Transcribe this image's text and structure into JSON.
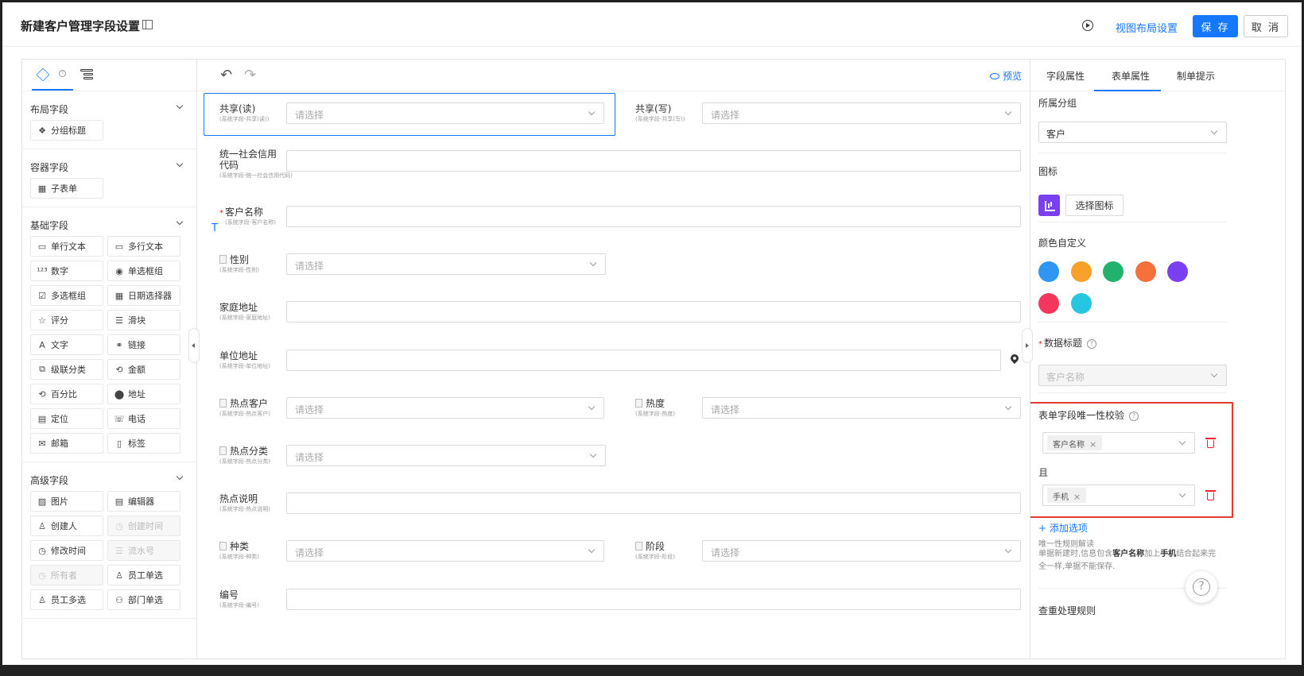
{
  "header": {
    "title": "新建客户管理字段设置",
    "view_layout_label": "视图布局设置",
    "save_label": "保 存",
    "cancel_label": "取 消"
  },
  "left_panel": {
    "groups": [
      {
        "name": "布局字段",
        "items": [
          {
            "label": "分组标题",
            "icon": "❖"
          }
        ]
      },
      {
        "name": "容器字段",
        "items": [
          {
            "label": "子表单",
            "icon": "▦"
          }
        ]
      },
      {
        "name": "基础字段",
        "items": [
          {
            "label": "单行文本",
            "icon": "▭"
          },
          {
            "label": "多行文本",
            "icon": "▭"
          },
          {
            "label": "数字",
            "icon": "¹²³"
          },
          {
            "label": "单选框组",
            "icon": "◉"
          },
          {
            "label": "多选框组",
            "icon": "☑"
          },
          {
            "label": "日期选择器",
            "icon": "▦"
          },
          {
            "label": "评分",
            "icon": "☆"
          },
          {
            "label": "滑块",
            "icon": "☰"
          },
          {
            "label": "文字",
            "icon": "A"
          },
          {
            "label": "链接",
            "icon": "⚭"
          },
          {
            "label": "级联分类",
            "icon": "⧉"
          },
          {
            "label": "金额",
            "icon": "⟲"
          },
          {
            "label": "百分比",
            "icon": "⟲"
          },
          {
            "label": "地址",
            "icon": "⬤"
          },
          {
            "label": "定位",
            "icon": "▤"
          },
          {
            "label": "电话",
            "icon": "☏"
          },
          {
            "label": "邮箱",
            "icon": "✉"
          },
          {
            "label": "标签",
            "icon": "▯"
          }
        ]
      },
      {
        "name": "高级字段",
        "items": [
          {
            "label": "图片",
            "icon": "▨"
          },
          {
            "label": "编辑器",
            "icon": "▤"
          },
          {
            "label": "创建人",
            "icon": "♙"
          },
          {
            "label": "创建时间",
            "icon": "◷",
            "disabled": true
          },
          {
            "label": "修改时间",
            "icon": "◷"
          },
          {
            "label": "流水号",
            "icon": "☰",
            "disabled": true
          },
          {
            "label": "所有者",
            "icon": "◷",
            "disabled": true
          },
          {
            "label": "员工单选",
            "icon": "♙"
          },
          {
            "label": "员工多选",
            "icon": "♙"
          },
          {
            "label": "部门单选",
            "icon": "⚇"
          }
        ]
      }
    ]
  },
  "toolbar": {
    "preview_label": "预览"
  },
  "form": {
    "placeholder": "请选择",
    "fields": {
      "share_read": {
        "label": "共享(读)",
        "sub": "(系统字段-共享(读))"
      },
      "share_write": {
        "label": "共享(写)",
        "sub": "(系统字段-共享(写))"
      },
      "credit_code": {
        "label1": "统一社会信用",
        "label2": "代码",
        "sub": "(系统字段-统一社会信用代码)"
      },
      "customer_name": {
        "label": "客户名称",
        "sub": "(系统字段-客户名称)"
      },
      "gender": {
        "label": "性别",
        "sub": "(系统字段-性别)"
      },
      "home_address": {
        "label": "家庭地址",
        "sub": "(系统字段-家庭地址)"
      },
      "work_address": {
        "label": "单位地址",
        "sub": "(系统字段-单位地址)"
      },
      "hot_customer": {
        "label": "热点客户",
        "sub": "(系统字段-热点客户)"
      },
      "heat": {
        "label": "热度",
        "sub": "(系统字段-热度)"
      },
      "hot_category": {
        "label": "热点分类",
        "sub": "(系统字段-热点分类)"
      },
      "hot_desc": {
        "label": "热点说明",
        "sub": "(系统字段-热点说明)"
      },
      "kind": {
        "label": "种类",
        "sub": "(系统字段-种类)"
      },
      "stage": {
        "label": "阶段",
        "sub": "(系统字段-阶段)"
      },
      "number": {
        "label": "编号",
        "sub": "(系统字段-编号)"
      }
    }
  },
  "right_panel": {
    "tabs": [
      "字段属性",
      "表单属性",
      "制单提示"
    ],
    "group_label": "所属分组",
    "group_value": "客户",
    "icon_label": "图标",
    "choose_icon_label": "选择图标",
    "color_label": "颜色自定义",
    "colors": [
      "#2f96f3",
      "#f7a12b",
      "#23b26d",
      "#f5703b",
      "#7b3ff2",
      "#f5365c",
      "#26c6e0"
    ],
    "data_title_label": "数据标题",
    "data_title_value": "客户名称",
    "unique_label": "表单字段唯一性校验",
    "unique_tag_1": "客户名称",
    "and_label": "且",
    "unique_tag_2": "手机",
    "add_option_label": "+ 添加选项",
    "rule_title": "唯一性规则解读",
    "rule_desc_1": "单据新建时,信息包含",
    "rule_desc_b1": "客户名称",
    "rule_desc_2": "加上",
    "rule_desc_b2": "手机",
    "rule_desc_3": "结合起来完全一样,单据不能保存.",
    "dedupe_label": "查重处理规则"
  }
}
